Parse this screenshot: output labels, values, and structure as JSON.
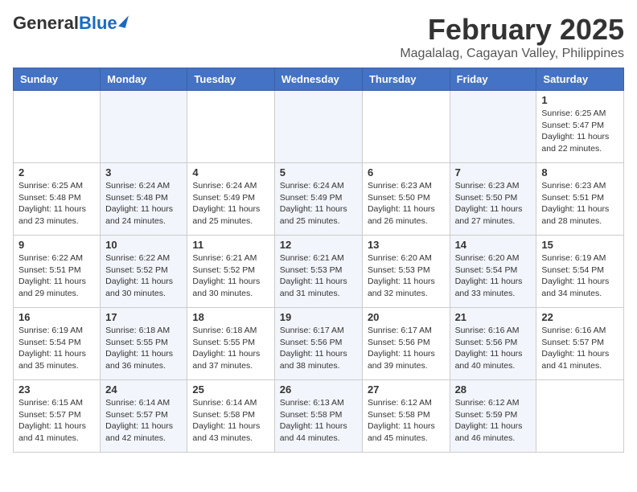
{
  "header": {
    "logo_general": "General",
    "logo_blue": "Blue",
    "month_title": "February 2025",
    "subtitle": "Magalalag, Cagayan Valley, Philippines"
  },
  "days_of_week": [
    "Sunday",
    "Monday",
    "Tuesday",
    "Wednesday",
    "Thursday",
    "Friday",
    "Saturday"
  ],
  "weeks": [
    [
      {
        "day": "",
        "info": ""
      },
      {
        "day": "",
        "info": ""
      },
      {
        "day": "",
        "info": ""
      },
      {
        "day": "",
        "info": ""
      },
      {
        "day": "",
        "info": ""
      },
      {
        "day": "",
        "info": ""
      },
      {
        "day": "1",
        "info": "Sunrise: 6:25 AM\nSunset: 5:47 PM\nDaylight: 11 hours\nand 22 minutes."
      }
    ],
    [
      {
        "day": "2",
        "info": "Sunrise: 6:25 AM\nSunset: 5:48 PM\nDaylight: 11 hours\nand 23 minutes."
      },
      {
        "day": "3",
        "info": "Sunrise: 6:24 AM\nSunset: 5:48 PM\nDaylight: 11 hours\nand 24 minutes."
      },
      {
        "day": "4",
        "info": "Sunrise: 6:24 AM\nSunset: 5:49 PM\nDaylight: 11 hours\nand 25 minutes."
      },
      {
        "day": "5",
        "info": "Sunrise: 6:24 AM\nSunset: 5:49 PM\nDaylight: 11 hours\nand 25 minutes."
      },
      {
        "day": "6",
        "info": "Sunrise: 6:23 AM\nSunset: 5:50 PM\nDaylight: 11 hours\nand 26 minutes."
      },
      {
        "day": "7",
        "info": "Sunrise: 6:23 AM\nSunset: 5:50 PM\nDaylight: 11 hours\nand 27 minutes."
      },
      {
        "day": "8",
        "info": "Sunrise: 6:23 AM\nSunset: 5:51 PM\nDaylight: 11 hours\nand 28 minutes."
      }
    ],
    [
      {
        "day": "9",
        "info": "Sunrise: 6:22 AM\nSunset: 5:51 PM\nDaylight: 11 hours\nand 29 minutes."
      },
      {
        "day": "10",
        "info": "Sunrise: 6:22 AM\nSunset: 5:52 PM\nDaylight: 11 hours\nand 30 minutes."
      },
      {
        "day": "11",
        "info": "Sunrise: 6:21 AM\nSunset: 5:52 PM\nDaylight: 11 hours\nand 30 minutes."
      },
      {
        "day": "12",
        "info": "Sunrise: 6:21 AM\nSunset: 5:53 PM\nDaylight: 11 hours\nand 31 minutes."
      },
      {
        "day": "13",
        "info": "Sunrise: 6:20 AM\nSunset: 5:53 PM\nDaylight: 11 hours\nand 32 minutes."
      },
      {
        "day": "14",
        "info": "Sunrise: 6:20 AM\nSunset: 5:54 PM\nDaylight: 11 hours\nand 33 minutes."
      },
      {
        "day": "15",
        "info": "Sunrise: 6:19 AM\nSunset: 5:54 PM\nDaylight: 11 hours\nand 34 minutes."
      }
    ],
    [
      {
        "day": "16",
        "info": "Sunrise: 6:19 AM\nSunset: 5:54 PM\nDaylight: 11 hours\nand 35 minutes."
      },
      {
        "day": "17",
        "info": "Sunrise: 6:18 AM\nSunset: 5:55 PM\nDaylight: 11 hours\nand 36 minutes."
      },
      {
        "day": "18",
        "info": "Sunrise: 6:18 AM\nSunset: 5:55 PM\nDaylight: 11 hours\nand 37 minutes."
      },
      {
        "day": "19",
        "info": "Sunrise: 6:17 AM\nSunset: 5:56 PM\nDaylight: 11 hours\nand 38 minutes."
      },
      {
        "day": "20",
        "info": "Sunrise: 6:17 AM\nSunset: 5:56 PM\nDaylight: 11 hours\nand 39 minutes."
      },
      {
        "day": "21",
        "info": "Sunrise: 6:16 AM\nSunset: 5:56 PM\nDaylight: 11 hours\nand 40 minutes."
      },
      {
        "day": "22",
        "info": "Sunrise: 6:16 AM\nSunset: 5:57 PM\nDaylight: 11 hours\nand 41 minutes."
      }
    ],
    [
      {
        "day": "23",
        "info": "Sunrise: 6:15 AM\nSunset: 5:57 PM\nDaylight: 11 hours\nand 41 minutes."
      },
      {
        "day": "24",
        "info": "Sunrise: 6:14 AM\nSunset: 5:57 PM\nDaylight: 11 hours\nand 42 minutes."
      },
      {
        "day": "25",
        "info": "Sunrise: 6:14 AM\nSunset: 5:58 PM\nDaylight: 11 hours\nand 43 minutes."
      },
      {
        "day": "26",
        "info": "Sunrise: 6:13 AM\nSunset: 5:58 PM\nDaylight: 11 hours\nand 44 minutes."
      },
      {
        "day": "27",
        "info": "Sunrise: 6:12 AM\nSunset: 5:58 PM\nDaylight: 11 hours\nand 45 minutes."
      },
      {
        "day": "28",
        "info": "Sunrise: 6:12 AM\nSunset: 5:59 PM\nDaylight: 11 hours\nand 46 minutes."
      },
      {
        "day": "",
        "info": ""
      }
    ]
  ]
}
